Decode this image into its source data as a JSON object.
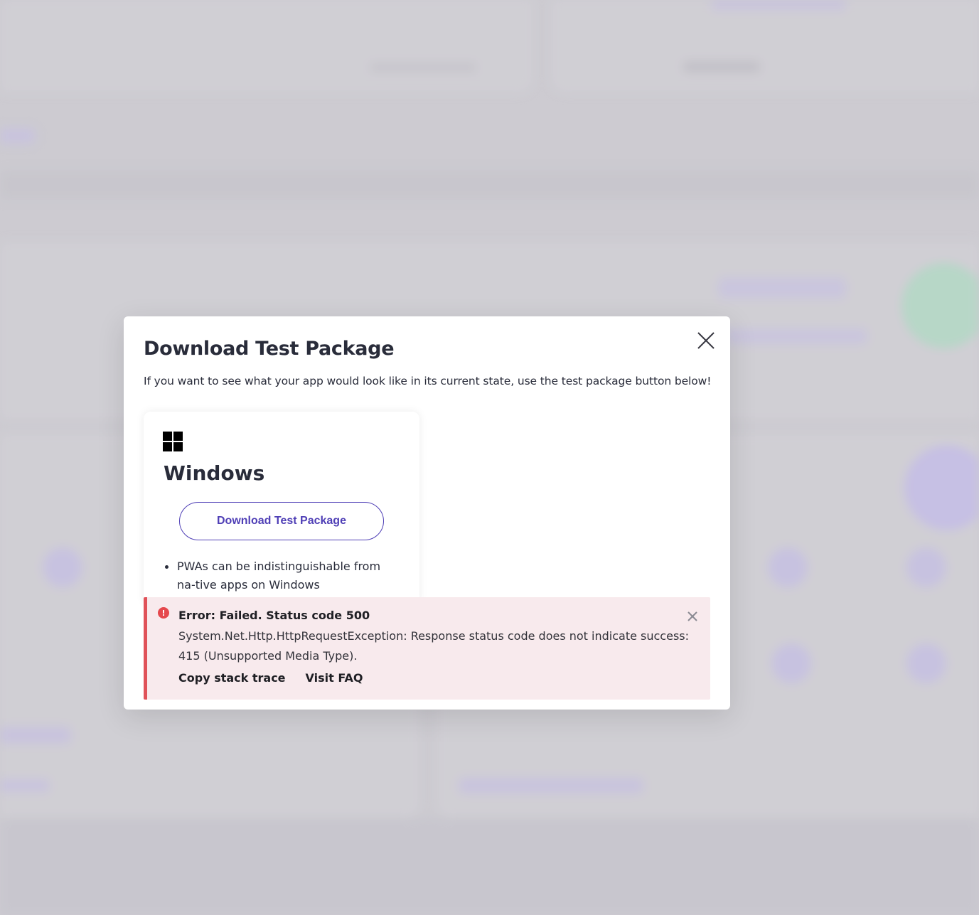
{
  "modal": {
    "title": "Download Test Package",
    "description": "If you want to see what your app would look like in its current state, use the test package button below!",
    "close_icon": "close-icon"
  },
  "platform_card": {
    "icon": "windows-logo-icon",
    "name": "Windows",
    "download_button_label": "Download Test Package",
    "features": [
      "PWAs can be indistinguishable from na-tive apps on Windows"
    ]
  },
  "error": {
    "icon": "error-icon",
    "icon_glyph": "!",
    "title": "Error: Failed. Status code 500",
    "message": "System.Net.Http.HttpRequestException: Response status code does not indicate success: 415 (Unsupported Media Type).",
    "actions": {
      "copy_stack_trace": "Copy stack trace",
      "visit_faq": "Visit FAQ"
    },
    "close_icon": "close-icon"
  },
  "colors": {
    "accent": "#4f3fb6",
    "error_border": "#e05259",
    "error_background": "#f8eaed",
    "text": "#292c3a",
    "backdrop": "#cfced3"
  }
}
